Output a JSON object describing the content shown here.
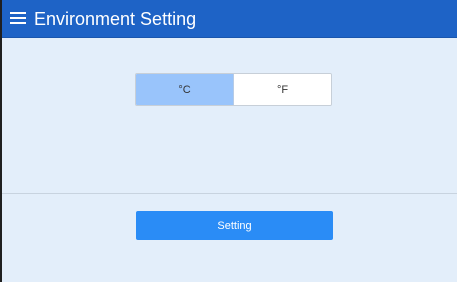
{
  "header": {
    "title": "Environment Setting",
    "menu_icon": "hamburger-menu-icon",
    "background_color": "#1e63c6"
  },
  "temperature_unit": {
    "options": [
      {
        "label": "°C",
        "selected": true
      },
      {
        "label": "°F",
        "selected": false
      }
    ],
    "selected_color": "#99c4fb"
  },
  "actions": {
    "setting_label": "Setting",
    "button_color": "#2a8cf6"
  }
}
